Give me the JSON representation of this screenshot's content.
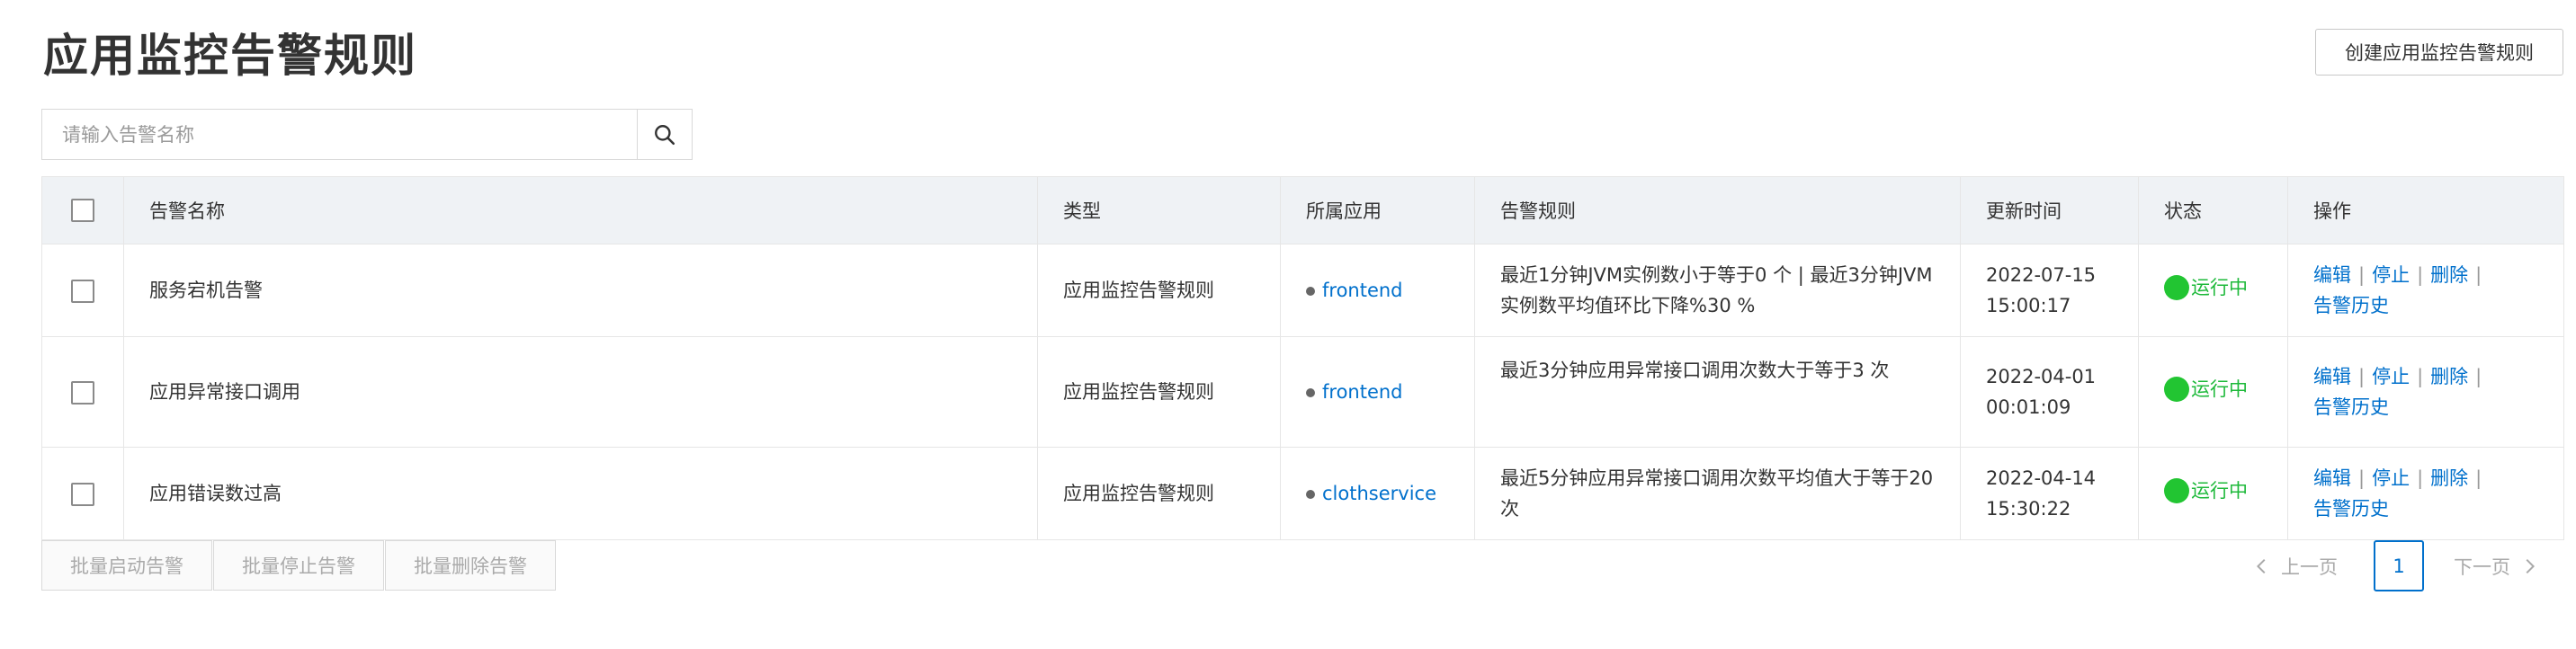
{
  "page": {
    "title": "应用监控告警规则",
    "create_button": "创建应用监控告警规则"
  },
  "search": {
    "placeholder": "请输入告警名称",
    "icon": "search-icon"
  },
  "table": {
    "headers": [
      "告警名称",
      "类型",
      "所属应用",
      "告警规则",
      "更新时间",
      "状态",
      "操作"
    ],
    "rows": [
      {
        "name": "服务宕机告警",
        "type": "应用监控告警规则",
        "app": "frontend",
        "rule": "最近1分钟JVM实例数小于等于0 个 | 最近3分钟JVM实例数平均值环比下降%30 %",
        "updated_date": "2022-07-15",
        "updated_time": "15:00:17",
        "status": "运行中"
      },
      {
        "name": "应用异常接口调用",
        "type": "应用监控告警规则",
        "app": "frontend",
        "rule": "最近3分钟应用异常接口调用次数大于等于3 次",
        "updated_date": "2022-04-01",
        "updated_time": "00:01:09",
        "status": "运行中"
      },
      {
        "name": "应用错误数过高",
        "type": "应用监控告警规则",
        "app": "clothservice",
        "rule": "最近5分钟应用异常接口调用次数平均值大于等于20 次",
        "updated_date": "2022-04-14",
        "updated_time": "15:30:22",
        "status": "运行中"
      }
    ],
    "actions": {
      "edit": "编辑",
      "stop": "停止",
      "delete": "删除",
      "history": "告警历史",
      "separator": "|"
    }
  },
  "batch": {
    "start": "批量启动告警",
    "stop": "批量停止告警",
    "delete": "批量删除告警"
  },
  "pagination": {
    "prev": "上一页",
    "current": "1",
    "next": "下一页"
  },
  "colors": {
    "link": "#0070cc",
    "status_running": "#1db93a",
    "header_bg": "#eff2f5"
  }
}
